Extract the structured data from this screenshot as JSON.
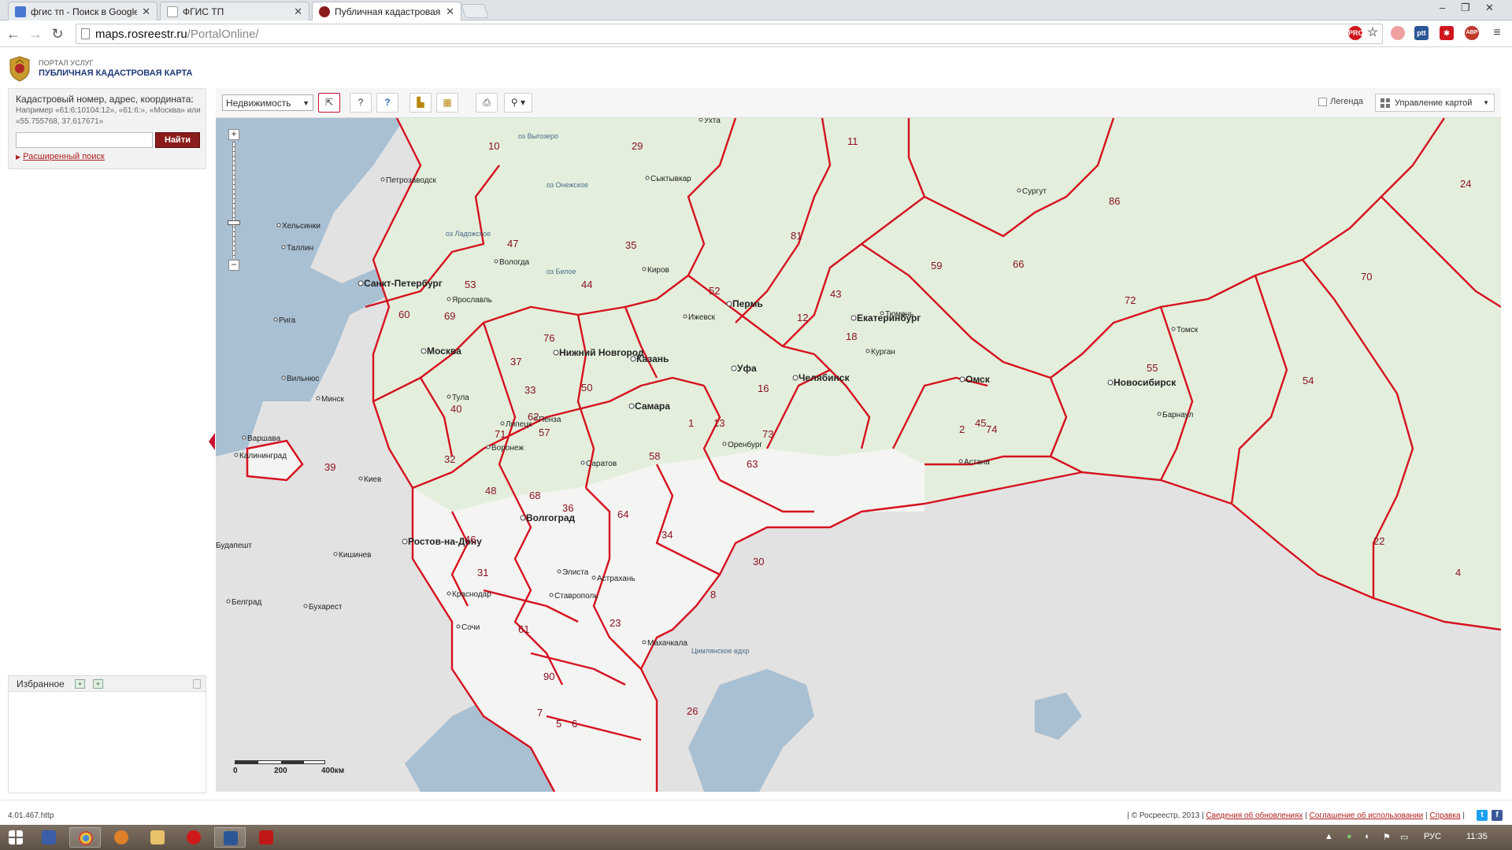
{
  "browser": {
    "tabs": [
      {
        "title": "фгис тп - Поиск в Google",
        "favicon_color": "#4a78d4"
      },
      {
        "title": "ФГИС ТП",
        "favicon_color": "#ffffff"
      },
      {
        "title": "Публичная кадастровая к",
        "favicon_color": "#8a1c1c"
      }
    ],
    "url_domain": "maps.rosreestr.ru",
    "url_path": "/PortalOnline/",
    "controls": {
      "minimize": "–",
      "restore": "❐",
      "close": "✕",
      "close_tab": "✕"
    },
    "extensions": [
      {
        "name": "pro-extension",
        "label": "PRO",
        "color": "#d0161e"
      },
      {
        "name": "rt-extension",
        "label": "ptt",
        "color": "#2b5797"
      },
      {
        "name": "asterisk-extension",
        "label": "✱",
        "color": "#d0161e"
      },
      {
        "name": "adblock-extension",
        "label": "ABP",
        "color": "#c0392b"
      }
    ]
  },
  "portal": {
    "subtitle": "ПОРТАЛ УСЛУГ",
    "title": "ПУБЛИЧНАЯ КАДАСТРОВАЯ КАРТА"
  },
  "search": {
    "label": "Кадастровый номер, адрес, координата:",
    "example": "Например «61:6:10104:12», «61:6:», «Москва» или «55.755768, 37.617671»",
    "input_value": "",
    "button": "Найти",
    "advanced_link": "Расширенный поиск"
  },
  "favorites": {
    "title": "Избранное"
  },
  "map_toolbar": {
    "layer_select": "Недвижимость",
    "legend_label": "Легенда",
    "manage_label": "Управление картой"
  },
  "map": {
    "colors": {
      "boundary": "#d6111f",
      "land": "#e3efdc",
      "land_south": "#f4f4f2",
      "sea": "#a9bfd2",
      "foreign": "#e2e2e2"
    },
    "cities": [
      {
        "name": "Санкт-Петербург",
        "bold": true
      },
      {
        "name": "Москва",
        "bold": true
      },
      {
        "name": "Нижний Новгород",
        "bold": true
      },
      {
        "name": "Казань",
        "bold": true
      },
      {
        "name": "Пермь",
        "bold": true
      },
      {
        "name": "Екатеринбург",
        "bold": true
      },
      {
        "name": "Уфа",
        "bold": true
      },
      {
        "name": "Челябинск",
        "bold": true
      },
      {
        "name": "Омск",
        "bold": true
      },
      {
        "name": "Новосибирск",
        "bold": true
      },
      {
        "name": "Самара",
        "bold": true
      },
      {
        "name": "Волгоград",
        "bold": true
      },
      {
        "name": "Ростов-на-Дону",
        "bold": true
      },
      {
        "name": "Краснодар",
        "bold": false
      },
      {
        "name": "Воронеж",
        "bold": false
      },
      {
        "name": "Саратов",
        "bold": false
      },
      {
        "name": "Тюмень",
        "bold": false
      },
      {
        "name": "Ярославль",
        "bold": false
      },
      {
        "name": "Тула",
        "bold": false
      },
      {
        "name": "Липецк",
        "bold": false
      },
      {
        "name": "Пенза",
        "bold": false
      },
      {
        "name": "Ижевск",
        "bold": false
      },
      {
        "name": "Курган",
        "bold": false
      },
      {
        "name": "Оренбург",
        "bold": false
      },
      {
        "name": "Астрахань",
        "bold": false
      },
      {
        "name": "Барнаул",
        "bold": false
      },
      {
        "name": "Томск",
        "bold": false
      },
      {
        "name": "Киров",
        "bold": false
      },
      {
        "name": "Вологда",
        "bold": false
      },
      {
        "name": "Калининград",
        "bold": false
      },
      {
        "name": "Хельсинки",
        "bold": false
      },
      {
        "name": "Таллин",
        "bold": false
      },
      {
        "name": "Рига",
        "bold": false
      },
      {
        "name": "Вильнюс",
        "bold": false
      },
      {
        "name": "Минск",
        "bold": false
      },
      {
        "name": "Варшава",
        "bold": false
      },
      {
        "name": "Киев",
        "bold": false
      },
      {
        "name": "Кишинев",
        "bold": false
      },
      {
        "name": "Будапешт",
        "bold": false
      },
      {
        "name": "Бухарест",
        "bold": false
      },
      {
        "name": "Белград",
        "bold": false
      },
      {
        "name": "Астана",
        "bold": false
      },
      {
        "name": "Элиста",
        "bold": false
      },
      {
        "name": "Сочи",
        "bold": false
      },
      {
        "name": "Махачкала",
        "bold": false
      },
      {
        "name": "Ставрополь",
        "bold": false
      },
      {
        "name": "Сургут",
        "bold": false
      },
      {
        "name": "Ухта",
        "bold": false
      },
      {
        "name": "Сыктывкар",
        "bold": false
      },
      {
        "name": "Петрозаводск",
        "bold": false
      }
    ],
    "region_numbers": [
      "10",
      "29",
      "11",
      "24",
      "86",
      "35",
      "81",
      "59",
      "66",
      "70",
      "47",
      "53",
      "44",
      "12",
      "43",
      "52",
      "72",
      "60",
      "69",
      "37",
      "33",
      "18",
      "55",
      "54",
      "76",
      "50",
      "16",
      "45",
      "2",
      "74",
      "40",
      "71",
      "62",
      "13",
      "73",
      "1",
      "63",
      "57",
      "32",
      "48",
      "68",
      "58",
      "36",
      "46",
      "64",
      "34",
      "22",
      "4",
      "31",
      "23",
      "30",
      "8",
      "90",
      "61",
      "39",
      "26",
      "7",
      "5",
      "6"
    ],
    "water_labels": [
      "оз Онежское",
      "оз Ладожское",
      "оз Выгозеро",
      "оз Белое",
      "Цимлянское вдхр"
    ],
    "scale": {
      "labels": [
        "0",
        "200",
        "400км"
      ]
    }
  },
  "status": {
    "version": "4.01.467.http",
    "copyright": "© Росреестр, 2013",
    "link_updates": "Сведения об обновлениях",
    "link_terms": "Соглашение об использовании",
    "link_help": "Справка",
    "separator": "|"
  },
  "taskbar": {
    "lang": "РУС",
    "time": "11:35"
  }
}
